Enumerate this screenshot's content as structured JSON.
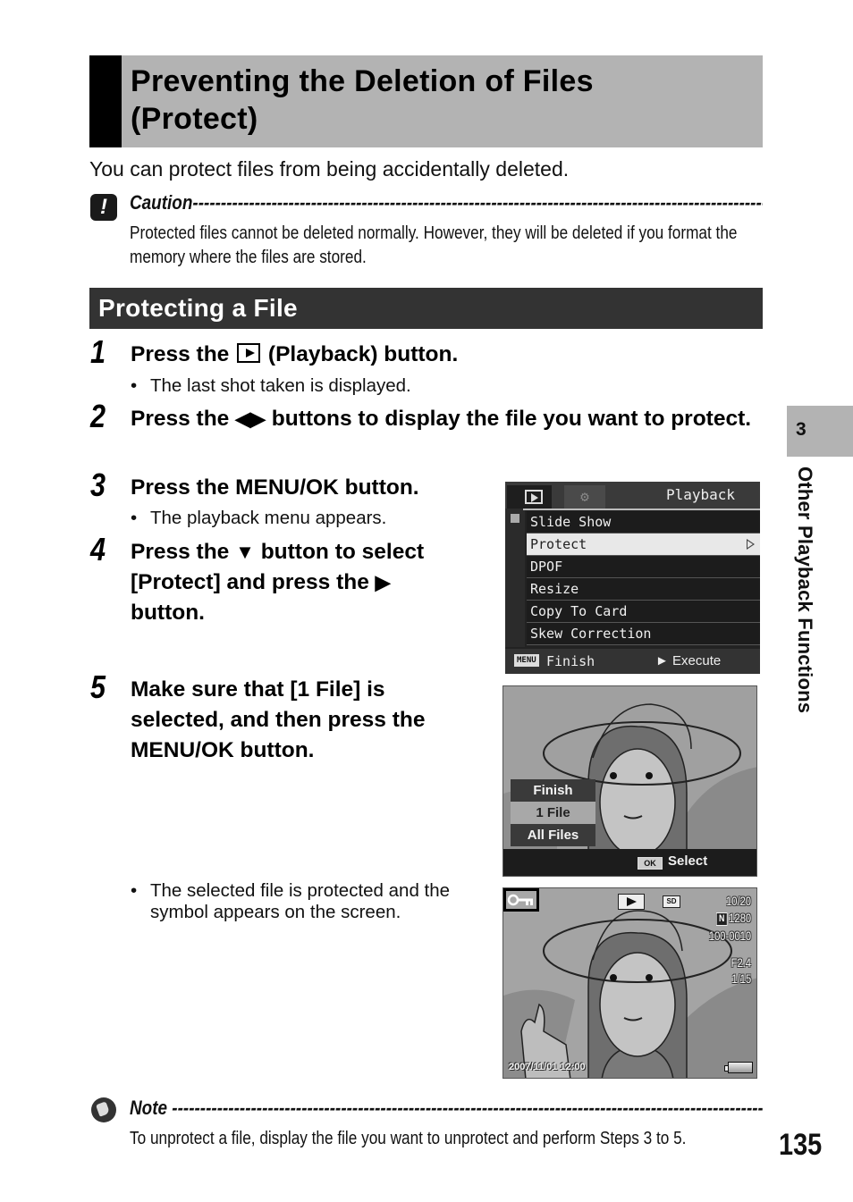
{
  "page": {
    "title_line1": "Preventing the Deletion of Files",
    "title_line2": "(Protect)",
    "intro": "You can protect files from being accidentally deleted.",
    "caution": {
      "icon": "exclamation-icon",
      "heading": "Caution-------------------------------------------------------------------------------------------------------",
      "body": "Protected files cannot be deleted normally. However, they will be deleted if you format the memory where the files are stored."
    },
    "section_title": "Protecting a File",
    "steps": [
      {
        "number": "1",
        "text_before": "Press the ",
        "icon": "playback-button-icon",
        "text_after": " (Playback) button.",
        "bullet": "The last shot taken is displayed."
      },
      {
        "number": "2",
        "text_before": "Press the ",
        "icon": "left-right-arrows-icon",
        "icon_glyph": "◀▶",
        "text_after": " buttons to display the file you want to protect."
      },
      {
        "number": "3",
        "text": "Press the MENU/OK button.",
        "bullet": "The playback menu appears."
      },
      {
        "number": "4",
        "line1_before": "Press the ",
        "down_glyph": "▼",
        "line1_after": " button to select",
        "line2_before": "[Protect] and press the ",
        "right_glyph": "▶",
        "line3": "button."
      },
      {
        "number": "5",
        "text": "Make sure that [1 File] is selected, and then press the MENU/OK button.",
        "bullet": "The selected file is protected and the symbol appears on the screen."
      }
    ],
    "bullet_char": "•"
  },
  "screen_menu": {
    "title": "Playback",
    "setup_tab_glyph": "⚙",
    "items": [
      "Slide Show",
      "Protect",
      "DPOF",
      "Resize",
      "Copy To Card",
      "Skew Correction"
    ],
    "selected_index": 1,
    "footer_menu_badge": "MENU",
    "footer_finish": "Finish",
    "footer_execute": "► Execute"
  },
  "screen_protect": {
    "options": [
      "Finish",
      "1 File",
      "All Files"
    ],
    "selected_index": 1,
    "ok_badge": "OK",
    "footer_label": "Select"
  },
  "screen_playback": {
    "protect_icon": "key-icon",
    "sd_label": "SD",
    "frame_count": "10/20",
    "quality_badge": "N",
    "image_size": "1280",
    "file_number": "100-0010",
    "aperture": "F2.4",
    "shutter": "1/15",
    "datetime": "2007/11/01  12:00"
  },
  "sidebar": {
    "chapter": "3",
    "label": "Other Playback Functions"
  },
  "note": {
    "heading": "Note ---------------------------------------------------------------------------------------------------------",
    "body": "To unprotect a file, display the file you want to unprotect and perform Steps 3 to 5."
  },
  "page_number": "135"
}
